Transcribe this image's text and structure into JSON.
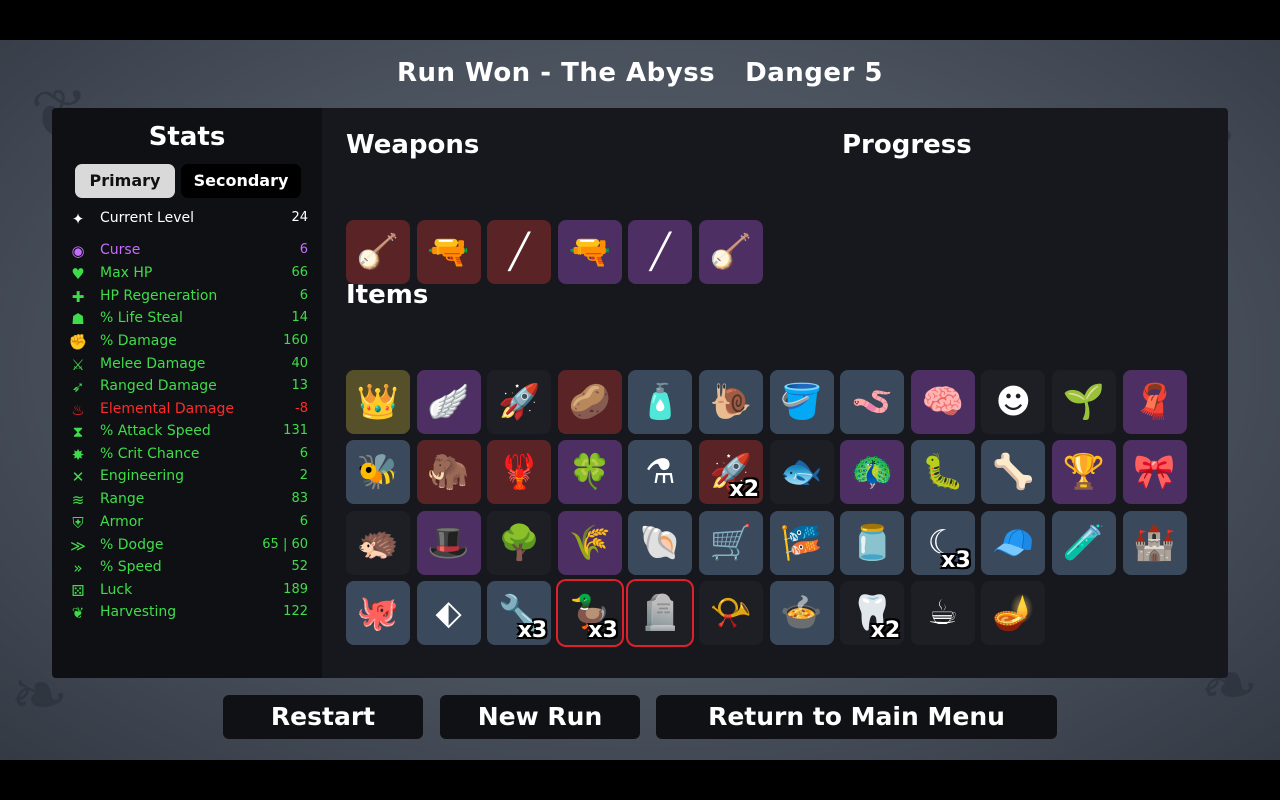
{
  "header": {
    "run_result": "Run Won - The Abyss",
    "danger": "Danger 5"
  },
  "colors": {
    "stat_green": "#3fdc4a",
    "stat_red": "#ff2a2a",
    "stat_purple": "#c66cff",
    "stat_white": "#ffffff",
    "tier_gray": "#1e1f24",
    "tier_blue": "#3a4a5c",
    "tier_purple": "#4d2f63",
    "tier_red": "#5a2426",
    "tier_gold": "#55502a",
    "selected_border": "#e0202a"
  },
  "stats": {
    "title": "Stats",
    "tabs": {
      "primary": "Primary",
      "secondary": "Secondary"
    },
    "rows": [
      {
        "icon": "level-icon",
        "glyph": "✦",
        "name": "Current Level",
        "value": "24",
        "color": "#ffffff"
      },
      {
        "icon": "curse-icon",
        "glyph": "◉",
        "name": "Curse",
        "value": "6",
        "color": "#c66cff"
      },
      {
        "icon": "heart-icon",
        "glyph": "♥",
        "name": "Max HP",
        "value": "66",
        "color": "#3fdc4a"
      },
      {
        "icon": "regen-icon",
        "glyph": "✚",
        "name": "HP Regeneration",
        "value": "6",
        "color": "#3fdc4a"
      },
      {
        "icon": "lifesteal-icon",
        "glyph": "☗",
        "name": "% Life Steal",
        "value": "14",
        "color": "#3fdc4a"
      },
      {
        "icon": "damage-icon",
        "glyph": "✊",
        "name": "% Damage",
        "value": "160",
        "color": "#3fdc4a"
      },
      {
        "icon": "melee-icon",
        "glyph": "⚔",
        "name": "Melee Damage",
        "value": "40",
        "color": "#3fdc4a"
      },
      {
        "icon": "ranged-icon",
        "glyph": "➶",
        "name": "Ranged Damage",
        "value": "13",
        "color": "#3fdc4a"
      },
      {
        "icon": "elemental-icon",
        "glyph": "♨",
        "name": "Elemental Damage",
        "value": "-8",
        "color": "#ff2a2a"
      },
      {
        "icon": "attack-speed-icon",
        "glyph": "⧗",
        "name": "% Attack Speed",
        "value": "131",
        "color": "#3fdc4a"
      },
      {
        "icon": "crit-icon",
        "glyph": "✸",
        "name": "% Crit Chance",
        "value": "6",
        "color": "#3fdc4a"
      },
      {
        "icon": "engineering-icon",
        "glyph": "✕",
        "name": "Engineering",
        "value": "2",
        "color": "#3fdc4a"
      },
      {
        "icon": "range-icon",
        "glyph": "≋",
        "name": "Range",
        "value": "83",
        "color": "#3fdc4a"
      },
      {
        "icon": "armor-icon",
        "glyph": "⛨",
        "name": "Armor",
        "value": "6",
        "color": "#3fdc4a"
      },
      {
        "icon": "dodge-icon",
        "glyph": "≫",
        "name": "% Dodge",
        "value": "65 | 60",
        "color": "#3fdc4a"
      },
      {
        "icon": "speed-icon",
        "glyph": "»",
        "name": "% Speed",
        "value": "52",
        "color": "#3fdc4a"
      },
      {
        "icon": "luck-icon",
        "glyph": "⚄",
        "name": "Luck",
        "value": "189",
        "color": "#3fdc4a"
      },
      {
        "icon": "harvesting-icon",
        "glyph": "❦",
        "name": "Harvesting",
        "value": "122",
        "color": "#3fdc4a"
      }
    ]
  },
  "weapons": {
    "title": "Weapons",
    "slots": [
      {
        "icon": "lute-icon",
        "glyph": "🪕",
        "tier": "red"
      },
      {
        "icon": "minigun-icon",
        "glyph": "🔫",
        "tier": "red"
      },
      {
        "icon": "flute-icon",
        "glyph": "╱",
        "tier": "red"
      },
      {
        "icon": "minigun-icon",
        "glyph": "🔫",
        "tier": "purple"
      },
      {
        "icon": "flute-icon",
        "glyph": "╱",
        "tier": "purple"
      },
      {
        "icon": "lute-icon",
        "glyph": "🪕",
        "tier": "purple"
      }
    ]
  },
  "progress": {
    "title": "Progress"
  },
  "items": {
    "title": "Items",
    "rows": [
      [
        {
          "icon": "king-icon",
          "glyph": "👑",
          "tier": "gold",
          "qty": ""
        },
        {
          "icon": "wings-icon",
          "glyph": "🪽",
          "tier": "purple",
          "qty": ""
        },
        {
          "icon": "rocket-icon",
          "glyph": "🚀",
          "tier": "gray",
          "qty": ""
        },
        {
          "icon": "potato-icon",
          "glyph": "🥔",
          "tier": "red",
          "qty": ""
        },
        {
          "icon": "ketchup-icon",
          "glyph": "🧴",
          "tier": "blue",
          "qty": ""
        },
        {
          "icon": "snail-icon",
          "glyph": "🐌",
          "tier": "blue",
          "qty": ""
        },
        {
          "icon": "bucket-icon",
          "glyph": "🪣",
          "tier": "blue",
          "qty": ""
        },
        {
          "icon": "worm-icon",
          "glyph": "🪱",
          "tier": "blue",
          "qty": ""
        },
        {
          "icon": "brain-icon",
          "glyph": "🧠",
          "tier": "purple",
          "qty": ""
        },
        {
          "icon": "ghost-mask-icon",
          "glyph": "☻",
          "tier": "gray",
          "qty": ""
        },
        {
          "icon": "sprout-icon",
          "glyph": "🌱",
          "tier": "gray",
          "qty": ""
        },
        {
          "icon": "scarf-icon",
          "glyph": "🧣",
          "tier": "purple",
          "qty": ""
        }
      ],
      [
        {
          "icon": "wasp-icon",
          "glyph": "🐝",
          "tier": "blue",
          "qty": ""
        },
        {
          "icon": "mammoth-icon",
          "glyph": "🦣",
          "tier": "red",
          "qty": ""
        },
        {
          "icon": "lobster-claw-icon",
          "glyph": "🦞",
          "tier": "red",
          "qty": ""
        },
        {
          "icon": "clover-icon",
          "glyph": "🍀",
          "tier": "purple",
          "qty": ""
        },
        {
          "icon": "potion-icon",
          "glyph": "⚗",
          "tier": "blue",
          "qty": ""
        },
        {
          "icon": "missiles-icon",
          "glyph": "🚀",
          "tier": "red",
          "qty": "x2"
        },
        {
          "icon": "fish-icon",
          "glyph": "🐟",
          "tier": "gray",
          "qty": ""
        },
        {
          "icon": "peacock-icon",
          "glyph": "🦚",
          "tier": "purple",
          "qty": ""
        },
        {
          "icon": "tardigrade-icon",
          "glyph": "🐛",
          "tier": "blue",
          "qty": ""
        },
        {
          "icon": "cauldron-bones-icon",
          "glyph": "🦴",
          "tier": "blue",
          "qty": ""
        },
        {
          "icon": "chalice-icon",
          "glyph": "🏆",
          "tier": "purple",
          "qty": ""
        },
        {
          "icon": "bandana-icon",
          "glyph": "🎀",
          "tier": "purple",
          "qty": ""
        }
      ],
      [
        {
          "icon": "hedgehog-icon",
          "glyph": "🦔",
          "tier": "gray",
          "qty": ""
        },
        {
          "icon": "bowler-hat-icon",
          "glyph": "🎩",
          "tier": "purple",
          "qty": ""
        },
        {
          "icon": "tree-icon",
          "glyph": "🌳",
          "tier": "gray",
          "qty": ""
        },
        {
          "icon": "wheat-icon",
          "glyph": "🌾",
          "tier": "purple",
          "qty": ""
        },
        {
          "icon": "cornucopia-icon",
          "glyph": "🐚",
          "tier": "blue",
          "qty": ""
        },
        {
          "icon": "wheelbarrow-icon",
          "glyph": "🛒",
          "tier": "blue",
          "qty": ""
        },
        {
          "icon": "scarecrow-icon",
          "glyph": "🎏",
          "tier": "blue",
          "qty": ""
        },
        {
          "icon": "jar-icon",
          "glyph": "🫙",
          "tier": "blue",
          "qty": ""
        },
        {
          "icon": "claw-icon",
          "glyph": "☾",
          "tier": "blue",
          "qty": "x3"
        },
        {
          "icon": "propeller-hat-icon",
          "glyph": "🧢",
          "tier": "blue",
          "qty": ""
        },
        {
          "icon": "flask-icon",
          "glyph": "🧪",
          "tier": "blue",
          "qty": ""
        },
        {
          "icon": "sandcastle-icon",
          "glyph": "🏰",
          "tier": "blue",
          "qty": ""
        }
      ],
      [
        {
          "icon": "tentacle-icon",
          "glyph": "🐙",
          "tier": "blue",
          "qty": ""
        },
        {
          "icon": "shell-icon",
          "glyph": "⬖",
          "tier": "blue",
          "qty": ""
        },
        {
          "icon": "power-drill-icon",
          "glyph": "🔧",
          "tier": "blue",
          "qty": "x3"
        },
        {
          "icon": "rubber-duck-icon",
          "glyph": "🦆",
          "tier": "gray",
          "qty": "x3",
          "selected": true
        },
        {
          "icon": "tombstone-icon",
          "glyph": "🪦",
          "tier": "gray",
          "qty": "",
          "selected": true
        },
        {
          "icon": "whistle-icon",
          "glyph": "📯",
          "tier": "gray",
          "qty": ""
        },
        {
          "icon": "cauldron-icon",
          "glyph": "🍲",
          "tier": "blue",
          "qty": ""
        },
        {
          "icon": "fang-icon",
          "glyph": "🦷",
          "tier": "gray",
          "qty": "x2"
        },
        {
          "icon": "coffee-icon",
          "glyph": "☕",
          "tier": "gray",
          "qty": ""
        },
        {
          "icon": "genie-lamp-icon",
          "glyph": "🪔",
          "tier": "gray",
          "qty": ""
        }
      ]
    ]
  },
  "buttons": {
    "restart": "Restart",
    "new_run": "New Run",
    "main_menu": "Return to Main Menu"
  }
}
